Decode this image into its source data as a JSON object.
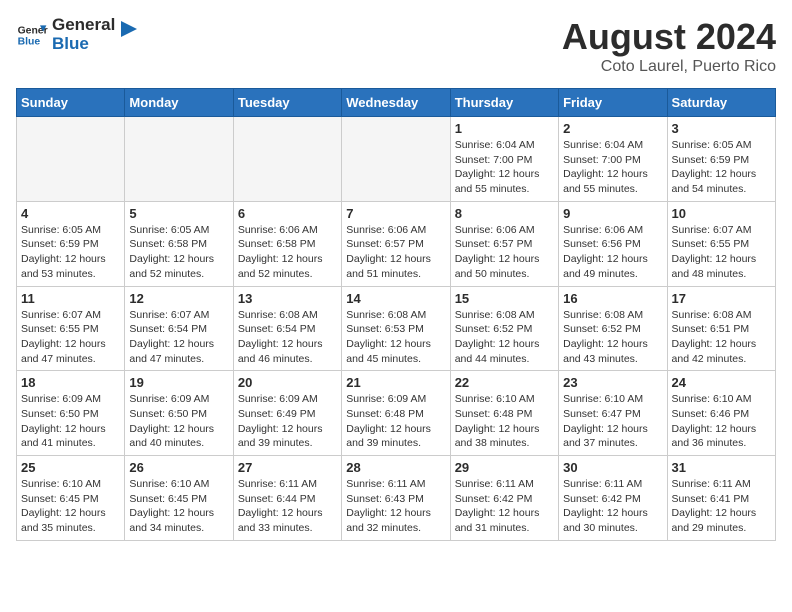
{
  "header": {
    "logo_line1": "General",
    "logo_line2": "Blue",
    "month_year": "August 2024",
    "location": "Coto Laurel, Puerto Rico"
  },
  "weekdays": [
    "Sunday",
    "Monday",
    "Tuesday",
    "Wednesday",
    "Thursday",
    "Friday",
    "Saturday"
  ],
  "weeks": [
    [
      {
        "day": "",
        "info": ""
      },
      {
        "day": "",
        "info": ""
      },
      {
        "day": "",
        "info": ""
      },
      {
        "day": "",
        "info": ""
      },
      {
        "day": "1",
        "info": "Sunrise: 6:04 AM\nSunset: 7:00 PM\nDaylight: 12 hours\nand 55 minutes."
      },
      {
        "day": "2",
        "info": "Sunrise: 6:04 AM\nSunset: 7:00 PM\nDaylight: 12 hours\nand 55 minutes."
      },
      {
        "day": "3",
        "info": "Sunrise: 6:05 AM\nSunset: 6:59 PM\nDaylight: 12 hours\nand 54 minutes."
      }
    ],
    [
      {
        "day": "4",
        "info": "Sunrise: 6:05 AM\nSunset: 6:59 PM\nDaylight: 12 hours\nand 53 minutes."
      },
      {
        "day": "5",
        "info": "Sunrise: 6:05 AM\nSunset: 6:58 PM\nDaylight: 12 hours\nand 52 minutes."
      },
      {
        "day": "6",
        "info": "Sunrise: 6:06 AM\nSunset: 6:58 PM\nDaylight: 12 hours\nand 52 minutes."
      },
      {
        "day": "7",
        "info": "Sunrise: 6:06 AM\nSunset: 6:57 PM\nDaylight: 12 hours\nand 51 minutes."
      },
      {
        "day": "8",
        "info": "Sunrise: 6:06 AM\nSunset: 6:57 PM\nDaylight: 12 hours\nand 50 minutes."
      },
      {
        "day": "9",
        "info": "Sunrise: 6:06 AM\nSunset: 6:56 PM\nDaylight: 12 hours\nand 49 minutes."
      },
      {
        "day": "10",
        "info": "Sunrise: 6:07 AM\nSunset: 6:55 PM\nDaylight: 12 hours\nand 48 minutes."
      }
    ],
    [
      {
        "day": "11",
        "info": "Sunrise: 6:07 AM\nSunset: 6:55 PM\nDaylight: 12 hours\nand 47 minutes."
      },
      {
        "day": "12",
        "info": "Sunrise: 6:07 AM\nSunset: 6:54 PM\nDaylight: 12 hours\nand 47 minutes."
      },
      {
        "day": "13",
        "info": "Sunrise: 6:08 AM\nSunset: 6:54 PM\nDaylight: 12 hours\nand 46 minutes."
      },
      {
        "day": "14",
        "info": "Sunrise: 6:08 AM\nSunset: 6:53 PM\nDaylight: 12 hours\nand 45 minutes."
      },
      {
        "day": "15",
        "info": "Sunrise: 6:08 AM\nSunset: 6:52 PM\nDaylight: 12 hours\nand 44 minutes."
      },
      {
        "day": "16",
        "info": "Sunrise: 6:08 AM\nSunset: 6:52 PM\nDaylight: 12 hours\nand 43 minutes."
      },
      {
        "day": "17",
        "info": "Sunrise: 6:08 AM\nSunset: 6:51 PM\nDaylight: 12 hours\nand 42 minutes."
      }
    ],
    [
      {
        "day": "18",
        "info": "Sunrise: 6:09 AM\nSunset: 6:50 PM\nDaylight: 12 hours\nand 41 minutes."
      },
      {
        "day": "19",
        "info": "Sunrise: 6:09 AM\nSunset: 6:50 PM\nDaylight: 12 hours\nand 40 minutes."
      },
      {
        "day": "20",
        "info": "Sunrise: 6:09 AM\nSunset: 6:49 PM\nDaylight: 12 hours\nand 39 minutes."
      },
      {
        "day": "21",
        "info": "Sunrise: 6:09 AM\nSunset: 6:48 PM\nDaylight: 12 hours\nand 39 minutes."
      },
      {
        "day": "22",
        "info": "Sunrise: 6:10 AM\nSunset: 6:48 PM\nDaylight: 12 hours\nand 38 minutes."
      },
      {
        "day": "23",
        "info": "Sunrise: 6:10 AM\nSunset: 6:47 PM\nDaylight: 12 hours\nand 37 minutes."
      },
      {
        "day": "24",
        "info": "Sunrise: 6:10 AM\nSunset: 6:46 PM\nDaylight: 12 hours\nand 36 minutes."
      }
    ],
    [
      {
        "day": "25",
        "info": "Sunrise: 6:10 AM\nSunset: 6:45 PM\nDaylight: 12 hours\nand 35 minutes."
      },
      {
        "day": "26",
        "info": "Sunrise: 6:10 AM\nSunset: 6:45 PM\nDaylight: 12 hours\nand 34 minutes."
      },
      {
        "day": "27",
        "info": "Sunrise: 6:11 AM\nSunset: 6:44 PM\nDaylight: 12 hours\nand 33 minutes."
      },
      {
        "day": "28",
        "info": "Sunrise: 6:11 AM\nSunset: 6:43 PM\nDaylight: 12 hours\nand 32 minutes."
      },
      {
        "day": "29",
        "info": "Sunrise: 6:11 AM\nSunset: 6:42 PM\nDaylight: 12 hours\nand 31 minutes."
      },
      {
        "day": "30",
        "info": "Sunrise: 6:11 AM\nSunset: 6:42 PM\nDaylight: 12 hours\nand 30 minutes."
      },
      {
        "day": "31",
        "info": "Sunrise: 6:11 AM\nSunset: 6:41 PM\nDaylight: 12 hours\nand 29 minutes."
      }
    ]
  ]
}
